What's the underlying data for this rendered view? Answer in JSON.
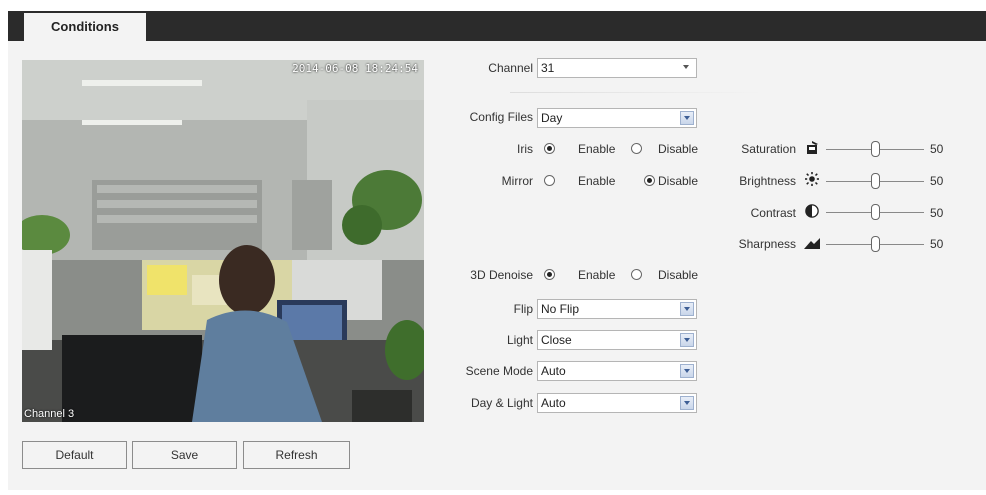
{
  "tab": {
    "label": "Conditions"
  },
  "video": {
    "timestamp": "2014-06-08 18:24:54",
    "channel_label": "Channel 3"
  },
  "channel": {
    "label": "Channel",
    "value": "31"
  },
  "config_files": {
    "label": "Config Files",
    "value": "Day"
  },
  "iris": {
    "label": "Iris",
    "enable": "Enable",
    "disable": "Disable",
    "selected": "enable"
  },
  "mirror": {
    "label": "Mirror",
    "enable": "Enable",
    "disable": "Disable",
    "selected": "disable"
  },
  "denoise": {
    "label": "3D Denoise",
    "enable": "Enable",
    "disable": "Disable",
    "selected": "enable"
  },
  "flip": {
    "label": "Flip",
    "value": "No Flip"
  },
  "light": {
    "label": "Light",
    "value": "Close"
  },
  "scene_mode": {
    "label": "Scene Mode",
    "value": "Auto"
  },
  "day_light": {
    "label": "Day & Light",
    "value": "Auto"
  },
  "sliders": {
    "saturation": {
      "label": "Saturation",
      "value": "50",
      "icon": "saturation-icon"
    },
    "brightness": {
      "label": "Brightness",
      "value": "50",
      "icon": "brightness-icon"
    },
    "contrast": {
      "label": "Contrast",
      "value": "50",
      "icon": "contrast-icon"
    },
    "sharpness": {
      "label": "Sharpness",
      "value": "50",
      "icon": "sharpness-icon"
    }
  },
  "buttons": {
    "default": "Default",
    "save": "Save",
    "refresh": "Refresh"
  }
}
